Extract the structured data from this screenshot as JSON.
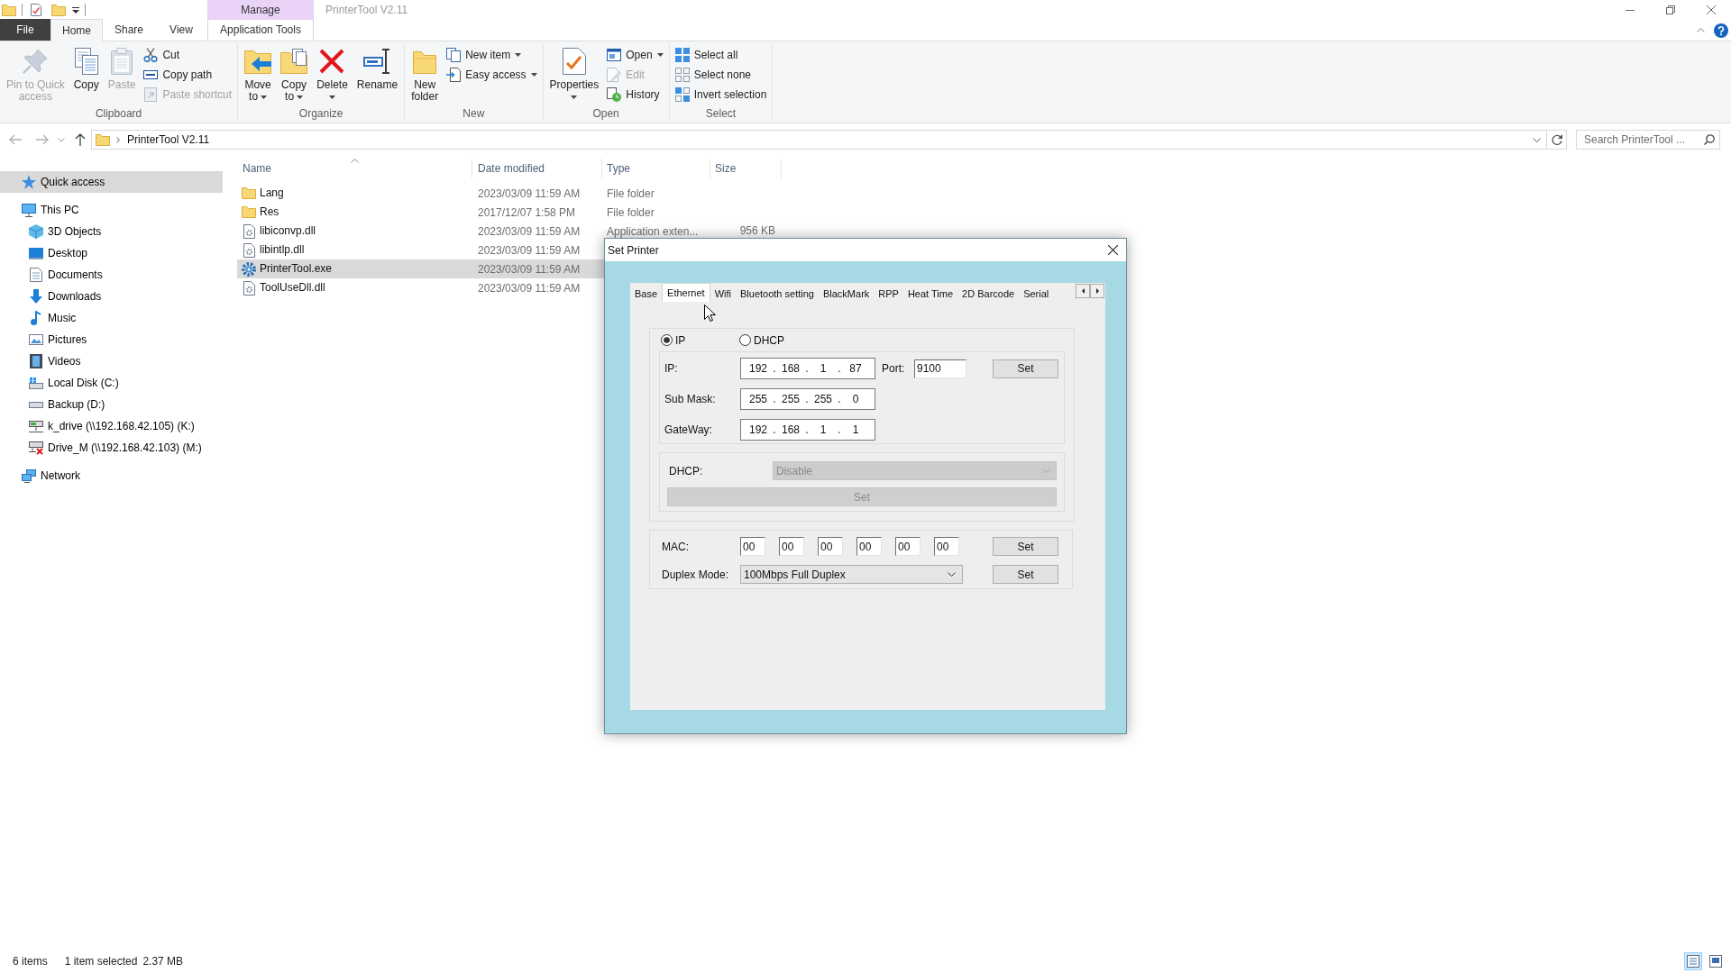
{
  "window": {
    "title": "PrinterTool V2.11"
  },
  "ribbon": {
    "contextual_header": "Manage",
    "tabs": [
      {
        "label": "File",
        "kind": "file",
        "selected": false
      },
      {
        "label": "Home",
        "kind": "normal",
        "selected": true
      },
      {
        "label": "Share",
        "kind": "normal",
        "selected": false
      },
      {
        "label": "View",
        "kind": "normal",
        "selected": false
      },
      {
        "label": "Application Tools",
        "kind": "contextual",
        "selected": false
      }
    ],
    "groups": [
      {
        "label": "Clipboard",
        "items": [
          {
            "kind": "large",
            "lines": [
              "Pin to Quick",
              "access"
            ],
            "disabled": true,
            "dropdown": false
          },
          {
            "kind": "large",
            "lines": [
              "Copy"
            ],
            "disabled": false,
            "dropdown": false
          },
          {
            "kind": "large",
            "lines": [
              "Paste"
            ],
            "disabled": true,
            "dropdown": false
          },
          {
            "kind": "stack",
            "entries": [
              {
                "label": "Cut",
                "disabled": false,
                "dropdown": false
              },
              {
                "label": "Copy path",
                "disabled": false,
                "dropdown": false
              },
              {
                "label": "Paste shortcut",
                "disabled": true,
                "dropdown": false
              }
            ]
          }
        ]
      },
      {
        "label": "Organize",
        "items": [
          {
            "kind": "large",
            "lines": [
              "Move",
              "to"
            ],
            "disabled": false,
            "dropdown": true
          },
          {
            "kind": "large",
            "lines": [
              "Copy",
              "to"
            ],
            "disabled": false,
            "dropdown": true
          },
          {
            "kind": "large",
            "lines": [
              "Delete"
            ],
            "disabled": false,
            "dropdown": true
          },
          {
            "kind": "large",
            "lines": [
              "Rename"
            ],
            "disabled": false,
            "dropdown": false
          }
        ]
      },
      {
        "label": "New",
        "items": [
          {
            "kind": "large",
            "lines": [
              "New",
              "folder"
            ],
            "disabled": false,
            "dropdown": false
          },
          {
            "kind": "stack",
            "entries": [
              {
                "label": "New item",
                "disabled": false,
                "dropdown": true
              },
              {
                "label": "Easy access",
                "disabled": false,
                "dropdown": true
              }
            ]
          }
        ]
      },
      {
        "label": "Open",
        "items": [
          {
            "kind": "large",
            "lines": [
              "Properties"
            ],
            "disabled": false,
            "dropdown": true
          },
          {
            "kind": "stack",
            "entries": [
              {
                "label": "Open",
                "disabled": false,
                "dropdown": true
              },
              {
                "label": "Edit",
                "disabled": true,
                "dropdown": false
              },
              {
                "label": "History",
                "disabled": false,
                "dropdown": false
              }
            ]
          }
        ]
      },
      {
        "label": "Select",
        "items": [
          {
            "kind": "stack",
            "entries": [
              {
                "label": "Select all",
                "disabled": false,
                "dropdown": false
              },
              {
                "label": "Select none",
                "disabled": false,
                "dropdown": false
              },
              {
                "label": "Invert selection",
                "disabled": false,
                "dropdown": false
              }
            ]
          }
        ]
      }
    ]
  },
  "address_bar": {
    "path": [
      "PrinterTool V2.11"
    ],
    "search": {
      "placeholder": "Search PrinterTool ..."
    }
  },
  "sidebar": {
    "items": [
      {
        "label": "Quick access",
        "selected": true
      },
      {
        "label": "This PC",
        "selected": false,
        "children": [
          {
            "label": "3D Objects",
            "selected": false
          },
          {
            "label": "Desktop",
            "selected": false
          },
          {
            "label": "Documents",
            "selected": false
          },
          {
            "label": "Downloads",
            "selected": false
          },
          {
            "label": "Music",
            "selected": false
          },
          {
            "label": "Pictures",
            "selected": false
          },
          {
            "label": "Videos",
            "selected": false
          },
          {
            "label": "Local Disk (C:)",
            "selected": false
          },
          {
            "label": "Backup (D:)",
            "selected": false
          },
          {
            "label": "k_drive (\\\\192.168.42.105) (K:)",
            "selected": false
          },
          {
            "label": "Drive_M (\\\\192.168.42.103) (M:)",
            "selected": false
          }
        ]
      },
      {
        "label": "Network",
        "selected": false
      }
    ]
  },
  "file_list": {
    "columns": [
      {
        "label": "Name",
        "sorted": true
      },
      {
        "label": "Date modified",
        "sorted": false
      },
      {
        "label": "Type",
        "sorted": false
      },
      {
        "label": "Size",
        "sorted": false
      }
    ],
    "rows": [
      {
        "kind": "folder",
        "name": "Lang",
        "date_modified": "2023/03/09 11:59 AM",
        "type": "File folder",
        "selected": false
      },
      {
        "kind": "folder",
        "name": "Res",
        "date_modified": "2017/12/07 1:58 PM",
        "type": "File folder",
        "selected": false
      },
      {
        "kind": "extension",
        "name": "libiconvp.dll",
        "date_modified": "2023/03/09 11:59 AM",
        "type": "Application exten...",
        "size": "956 KB",
        "selected": false
      },
      {
        "kind": "extension",
        "name": "libintlp.dll",
        "date_modified": "2023/03/09 11:59 AM",
        "selected": false
      },
      {
        "kind": "application",
        "name": "PrinterTool.exe",
        "date_modified": "2023/03/09 11:59 AM",
        "selected": true
      },
      {
        "kind": "extension",
        "name": "ToolUseDll.dll",
        "date_modified": "2023/03/09 11:59 AM",
        "selected": false
      }
    ]
  },
  "status_bar": {
    "item_count": "6 items",
    "selection": "1 item selected",
    "selection_size": "2.37 MB",
    "view_buttons": [
      {
        "selected": true
      },
      {
        "selected": false
      }
    ]
  },
  "dialog": {
    "title": "Set Printer",
    "tabs": [
      {
        "label": "Base",
        "selected": false
      },
      {
        "label": "Ethernet",
        "selected": true
      },
      {
        "label": "Wifi",
        "selected": false
      },
      {
        "label": "Bluetooth setting",
        "selected": false
      },
      {
        "label": "BlackMark",
        "selected": false
      },
      {
        "label": "RPP",
        "selected": false
      },
      {
        "label": "Heat Time",
        "selected": false
      },
      {
        "label": "2D Barcode",
        "selected": false
      },
      {
        "label": "Serial",
        "selected": false
      }
    ],
    "mode_radios": [
      {
        "label": "IP",
        "selected": true
      },
      {
        "label": "DHCP",
        "selected": false
      }
    ],
    "address_rows": [
      {
        "label": "IP:",
        "parts": [
          "192",
          ".",
          "168",
          ".",
          "1",
          ".",
          "87"
        ],
        "port_label": "Port:",
        "port": "9100",
        "button": "Set"
      },
      {
        "label": "Sub Mask:",
        "parts": [
          "255",
          ".",
          "255",
          ".",
          "255",
          ".",
          "0"
        ]
      },
      {
        "label": "GateWay:",
        "parts": [
          "192",
          ".",
          "168",
          ".",
          "1",
          ".",
          "1"
        ]
      }
    ],
    "dhcp": {
      "label": "DHCP:",
      "value": "Disable",
      "disabled": true,
      "button": "Set"
    },
    "mac": {
      "label": "MAC:",
      "bytes": [
        "00",
        "00",
        "00",
        "00",
        "00",
        "00"
      ],
      "button": "Set"
    },
    "duplex": {
      "label": "Duplex Mode:",
      "value": "100Mbps Full Duplex",
      "button": "Set"
    }
  }
}
